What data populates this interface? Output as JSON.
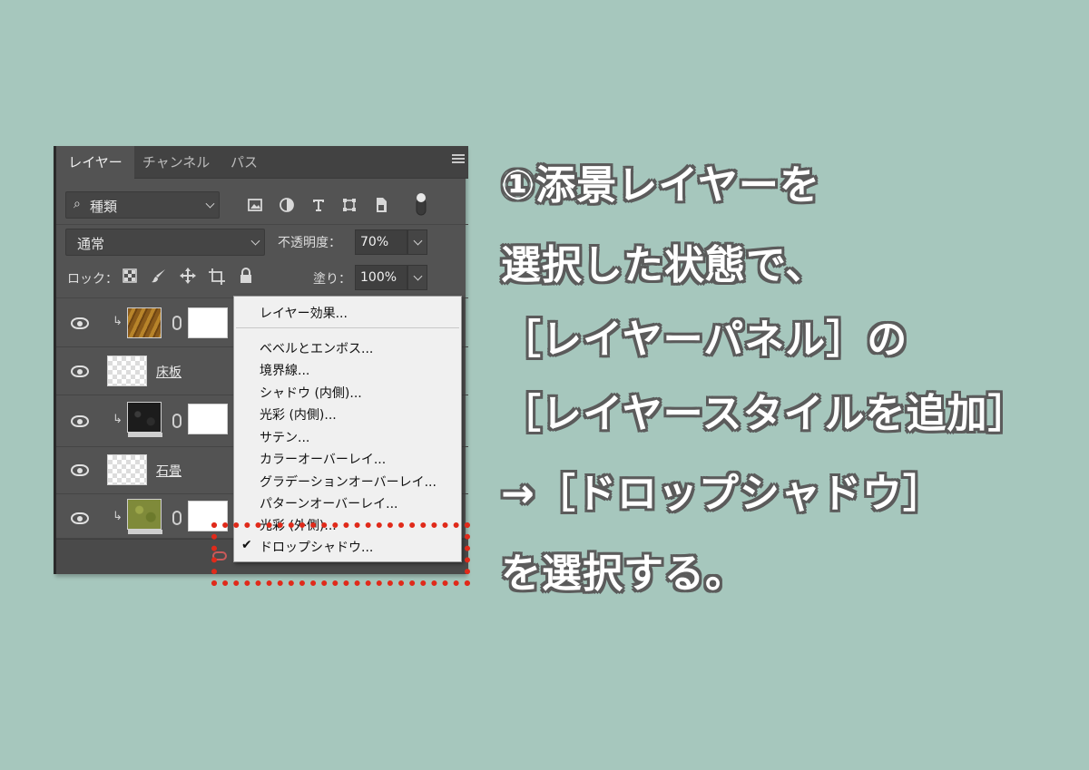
{
  "panel": {
    "tabs": [
      "レイヤー",
      "チャンネル",
      "パス"
    ],
    "filter_label": "種類",
    "blend_mode": "通常",
    "opacity_label": "不透明度：",
    "opacity_value": "70%",
    "lock_label": "ロック：",
    "fill_label": "塗り：",
    "fill_value": "100%",
    "filter_icons": [
      "image-filter-icon",
      "adjustment-filter-icon",
      "type-filter-icon",
      "shape-filter-icon",
      "smart-object-filter-icon",
      "filter-toggle-icon"
    ],
    "lock_icons": [
      "lock-transparent-icon",
      "lock-brush-icon",
      "lock-position-icon",
      "lock-artboard-icon",
      "lock-all-icon"
    ],
    "layers": [
      {
        "name": "",
        "thumb": "wood",
        "clipped": true,
        "mask": true
      },
      {
        "name": "床板",
        "thumb": "check",
        "clipped": false,
        "mask": false
      },
      {
        "name": "",
        "thumb": "dark",
        "clipped": true,
        "mask": true
      },
      {
        "name": "石畳",
        "thumb": "check",
        "clipped": false,
        "mask": false
      },
      {
        "name": "",
        "thumb": "moss",
        "clipped": true,
        "mask": true
      }
    ]
  },
  "menu": {
    "header_item": "レイヤー効果...",
    "items": [
      "ベベルとエンボス...",
      "境界線...",
      "シャドウ (内側)...",
      "光彩 (内側)...",
      "サテン...",
      "カラーオーバーレイ...",
      "グラデーションオーバーレイ...",
      "パターンオーバーレイ...",
      "光彩 (外側)...",
      "ドロップシャドウ..."
    ],
    "checked_item": "ドロップシャドウ...",
    "check_symbol": "✔"
  },
  "instructions": [
    "①添景レイヤーを",
    "選択した状態で、",
    "［レイヤーパネル］の",
    "［レイヤースタイルを追加］",
    "→［ドロップシャドウ］",
    "を選択する。"
  ],
  "colors": {
    "background": "#a6c7bd",
    "highlight": "#e02a1a"
  }
}
